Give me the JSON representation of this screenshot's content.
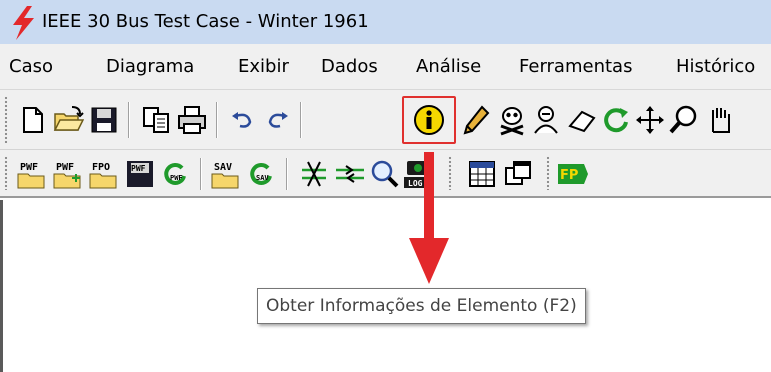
{
  "window": {
    "title": "IEEE 30 Bus Test Case - Winter 1961"
  },
  "menu": [
    {
      "label": "Caso"
    },
    {
      "label": "Diagrama"
    },
    {
      "label": "Exibir"
    },
    {
      "label": "Dados"
    },
    {
      "label": "Análise"
    },
    {
      "label": "Ferramentas"
    },
    {
      "label": "Histórico"
    }
  ],
  "toolbar1": {
    "icons": [
      "new-file-icon",
      "open-folder-icon",
      "save-icon",
      "copy-icon",
      "print-icon",
      "undo-icon",
      "redo-icon",
      "info-icon",
      "pencil-icon",
      "skull-crossbones-icon",
      "anonymous-user-icon",
      "eraser-icon",
      "refresh-icon",
      "move-icon",
      "zoom-icon",
      "pan-hand-icon"
    ],
    "highlighted": "info-icon"
  },
  "toolbar2": {
    "icons": [
      "open-pwf-icon",
      "append-pwf-icon",
      "open-fpo-icon",
      "save-pwf-icon",
      "reload-pwf-icon",
      "open-sav-icon",
      "reload-sav-icon",
      "cut-branch-icon",
      "merge-branch-icon",
      "zoom-network-icon",
      "log-icon",
      "calendar-grid-icon",
      "windows-icon",
      "fp-icon"
    ],
    "labels": {
      "pwf1": "PWF",
      "pwf2": "PWF",
      "fpo": "FPO",
      "pwf3": "PWF",
      "pwf4": "PWF",
      "sav1": "SAV",
      "sav2": "SAV",
      "log": "LOG",
      "fp": "FP"
    }
  },
  "tooltip": {
    "text": "Obter Informações de Elemento (F2)"
  },
  "colors": {
    "accent_red": "#e3282b",
    "highlight_border": "#e0302e",
    "title_bar": "#c9daf1"
  }
}
